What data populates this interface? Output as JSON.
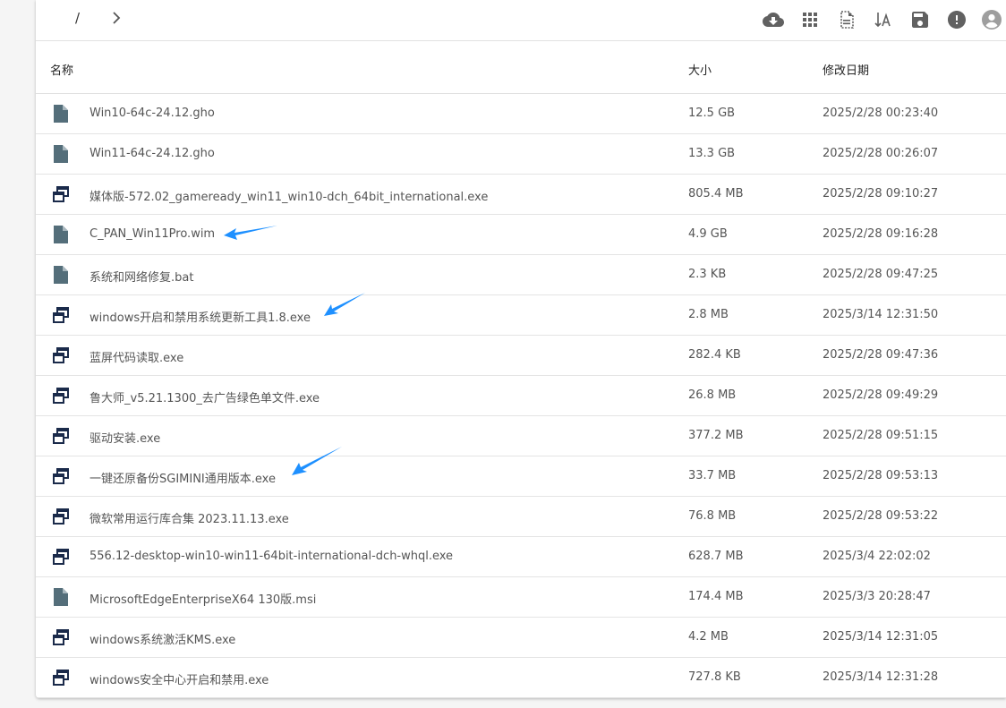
{
  "breadcrumb": {
    "separator": "/"
  },
  "toolbar_icons": [
    "cloud-download-icon",
    "grid-view-icon",
    "file-info-icon",
    "sort-by-name-icon",
    "save-icon",
    "info-alert-icon",
    "account-icon"
  ],
  "columns": {
    "name": "名称",
    "size": "大小",
    "modified": "修改日期"
  },
  "colors": {
    "icon": "#546e7a",
    "arrow": "#1e90ff",
    "text": "#555555"
  },
  "files": [
    {
      "name": "Win10-64c-24.12.gho",
      "size": "12.5 GB",
      "date": "2025/2/28 00:23:40",
      "icon": "file-icon"
    },
    {
      "name": "Win11-64c-24.12.gho",
      "size": "13.3 GB",
      "date": "2025/2/28 00:26:07",
      "icon": "file-icon"
    },
    {
      "name": "媒体版-572.02_gameready_win11_win10-dch_64bit_international.exe",
      "size": "805.4 MB",
      "date": "2025/2/28 09:10:27",
      "icon": "app-icon"
    },
    {
      "name": "C_PAN_Win11Pro.wim",
      "size": "4.9 GB",
      "date": "2025/2/28 09:16:28",
      "icon": "file-icon"
    },
    {
      "name": "系统和网络修复.bat",
      "size": "2.3 KB",
      "date": "2025/2/28 09:47:25",
      "icon": "file-icon"
    },
    {
      "name": "windows开启和禁用系统更新工具1.8.exe",
      "size": "2.8 MB",
      "date": "2025/3/14 12:31:50",
      "icon": "app-icon"
    },
    {
      "name": "蓝屏代码读取.exe",
      "size": "282.4 KB",
      "date": "2025/2/28 09:47:36",
      "icon": "app-icon"
    },
    {
      "name": "鲁大师_v5.21.1300_去广告绿色单文件.exe",
      "size": "26.8 MB",
      "date": "2025/2/28 09:49:29",
      "icon": "app-icon"
    },
    {
      "name": "驱动安装.exe",
      "size": "377.2 MB",
      "date": "2025/2/28 09:51:15",
      "icon": "app-icon"
    },
    {
      "name": "一键还原备份SGIMINI通用版本.exe",
      "size": "33.7 MB",
      "date": "2025/2/28 09:53:13",
      "icon": "app-icon"
    },
    {
      "name": "微软常用运行库合集 2023.11.13.exe",
      "size": "76.8 MB",
      "date": "2025/2/28 09:53:22",
      "icon": "app-icon"
    },
    {
      "name": "556.12-desktop-win10-win11-64bit-international-dch-whql.exe",
      "size": "628.7 MB",
      "date": "2025/3/4 22:02:02",
      "icon": "app-icon"
    },
    {
      "name": "MicrosoftEdgeEnterpriseX64 130版.msi",
      "size": "174.4 MB",
      "date": "2025/3/3 20:28:47",
      "icon": "file-icon"
    },
    {
      "name": "windows系统激活KMS.exe",
      "size": "4.2 MB",
      "date": "2025/3/14 12:31:05",
      "icon": "app-icon"
    },
    {
      "name": "windows安全中心开启和禁用.exe",
      "size": "727.8 KB",
      "date": "2025/3/14 12:31:28",
      "icon": "app-icon"
    }
  ],
  "annotation_arrows": [
    "arrow-annotation-icon",
    "arrow-annotation-icon",
    "arrow-annotation-icon"
  ]
}
